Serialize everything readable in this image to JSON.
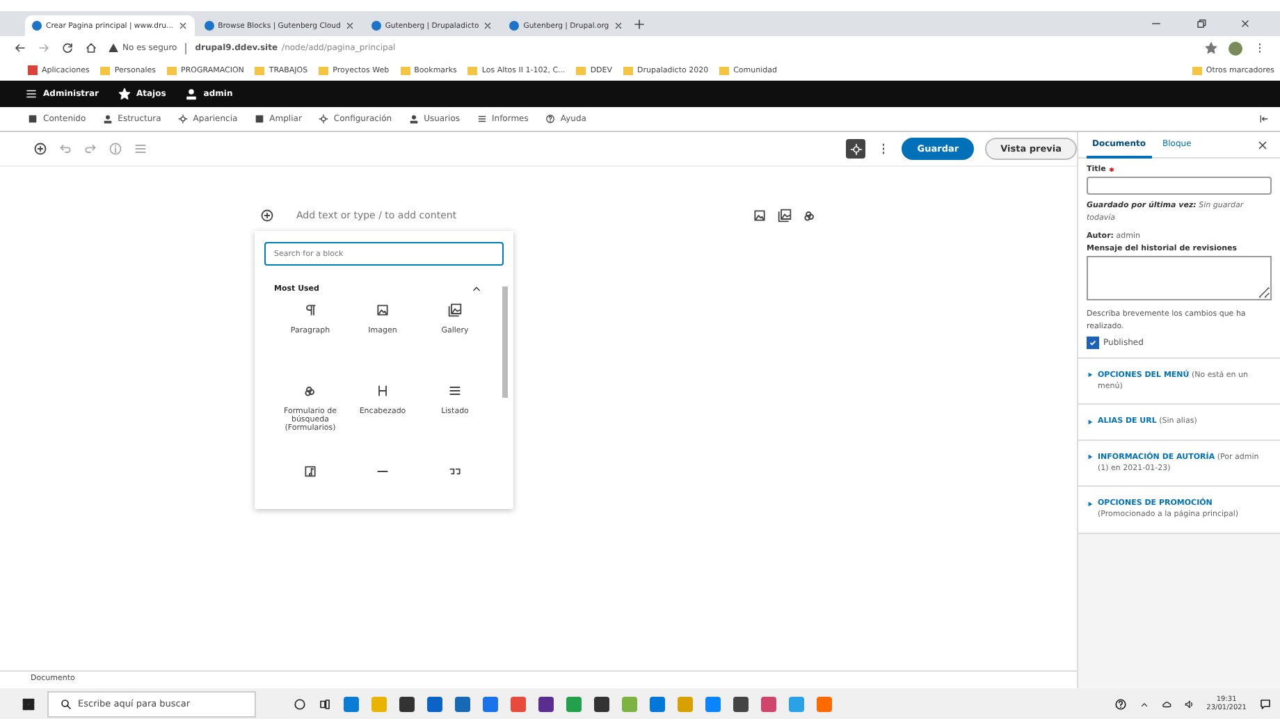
{
  "browser": {
    "tabs": [
      {
        "label": "Crear Pagina principal | www.dru...",
        "selected": true
      },
      {
        "label": "Browse Blocks | Gutenberg Cloud",
        "selected": false
      },
      {
        "label": "Gutenberg | Drupaladicto",
        "selected": false
      },
      {
        "label": "Gutenberg | Drupal.org",
        "selected": false
      }
    ],
    "address": {
      "security": "No es seguro",
      "host": "drupal9.ddev.site",
      "path": "/node/add/pagina_principal"
    },
    "bookmarks": [
      "Aplicaciones",
      "Personales",
      "PROGRAMACION",
      "TRABAJOS",
      "Proyectos Web",
      "Bookmarks",
      "Los Altos II 1-102, C...",
      "DDEV",
      "Drupaladicto 2020",
      "Comunidad"
    ],
    "other_bookmarks": "Otros marcadores"
  },
  "admin_bar": [
    "Administrar",
    "Atajos",
    "admin"
  ],
  "admin_menu": [
    "Contenido",
    "Estructura",
    "Apariencia",
    "Ampliar",
    "Configuración",
    "Usuarios",
    "Informes",
    "Ayuda"
  ],
  "editor": {
    "placeholder": "Add text or type / to add content",
    "save": "Guardar",
    "preview": "Vista previa"
  },
  "inserter": {
    "search_placeholder": "Search for a block",
    "section": "Most Used",
    "expanded": true,
    "blocks": [
      {
        "label": "Paragraph",
        "kind": "paragraph"
      },
      {
        "label": "Imagen",
        "kind": "image"
      },
      {
        "label": "Gallery",
        "kind": "gallery"
      },
      {
        "label": "Formulario de búsqueda (Formularios)",
        "kind": "search"
      },
      {
        "label": "Encabezado",
        "kind": "heading"
      },
      {
        "label": "Listado",
        "kind": "list"
      },
      {
        "kind": "audio"
      },
      {
        "kind": "separator"
      },
      {
        "kind": "quote"
      }
    ]
  },
  "sidebar": {
    "tabs": [
      {
        "label": "Documento",
        "selected": true
      },
      {
        "label": "Bloque",
        "selected": false
      }
    ],
    "title_label": "Title",
    "saved_label": "Guardado por última vez:",
    "saved_value": "Sin guardar todavía",
    "author_label": "Autor:",
    "author_value": "admin",
    "revision_label": "Mensaje del historial de revisiones",
    "revision_help": "Describa brevemente los cambios que ha realizado.",
    "published": {
      "label": "Published",
      "checked": true
    },
    "panels": [
      {
        "title": "OPCIONES DEL MENÚ",
        "note": "(No está en un menú)"
      },
      {
        "title": "ALIAS DE URL",
        "note": "(Sin alias)"
      },
      {
        "title": "INFORMACIÓN DE AUTORÍA",
        "note": "(Por admin (1) en 2021-01-23)"
      },
      {
        "title": "OPCIONES DE PROMOCIÓN",
        "note": "(Promocionado a la página principal)"
      }
    ]
  },
  "breadcrumb": "Documento",
  "taskbar": {
    "search_placeholder": "Escribe aquí para buscar",
    "time": "19:31",
    "date": "23/01/2021"
  }
}
